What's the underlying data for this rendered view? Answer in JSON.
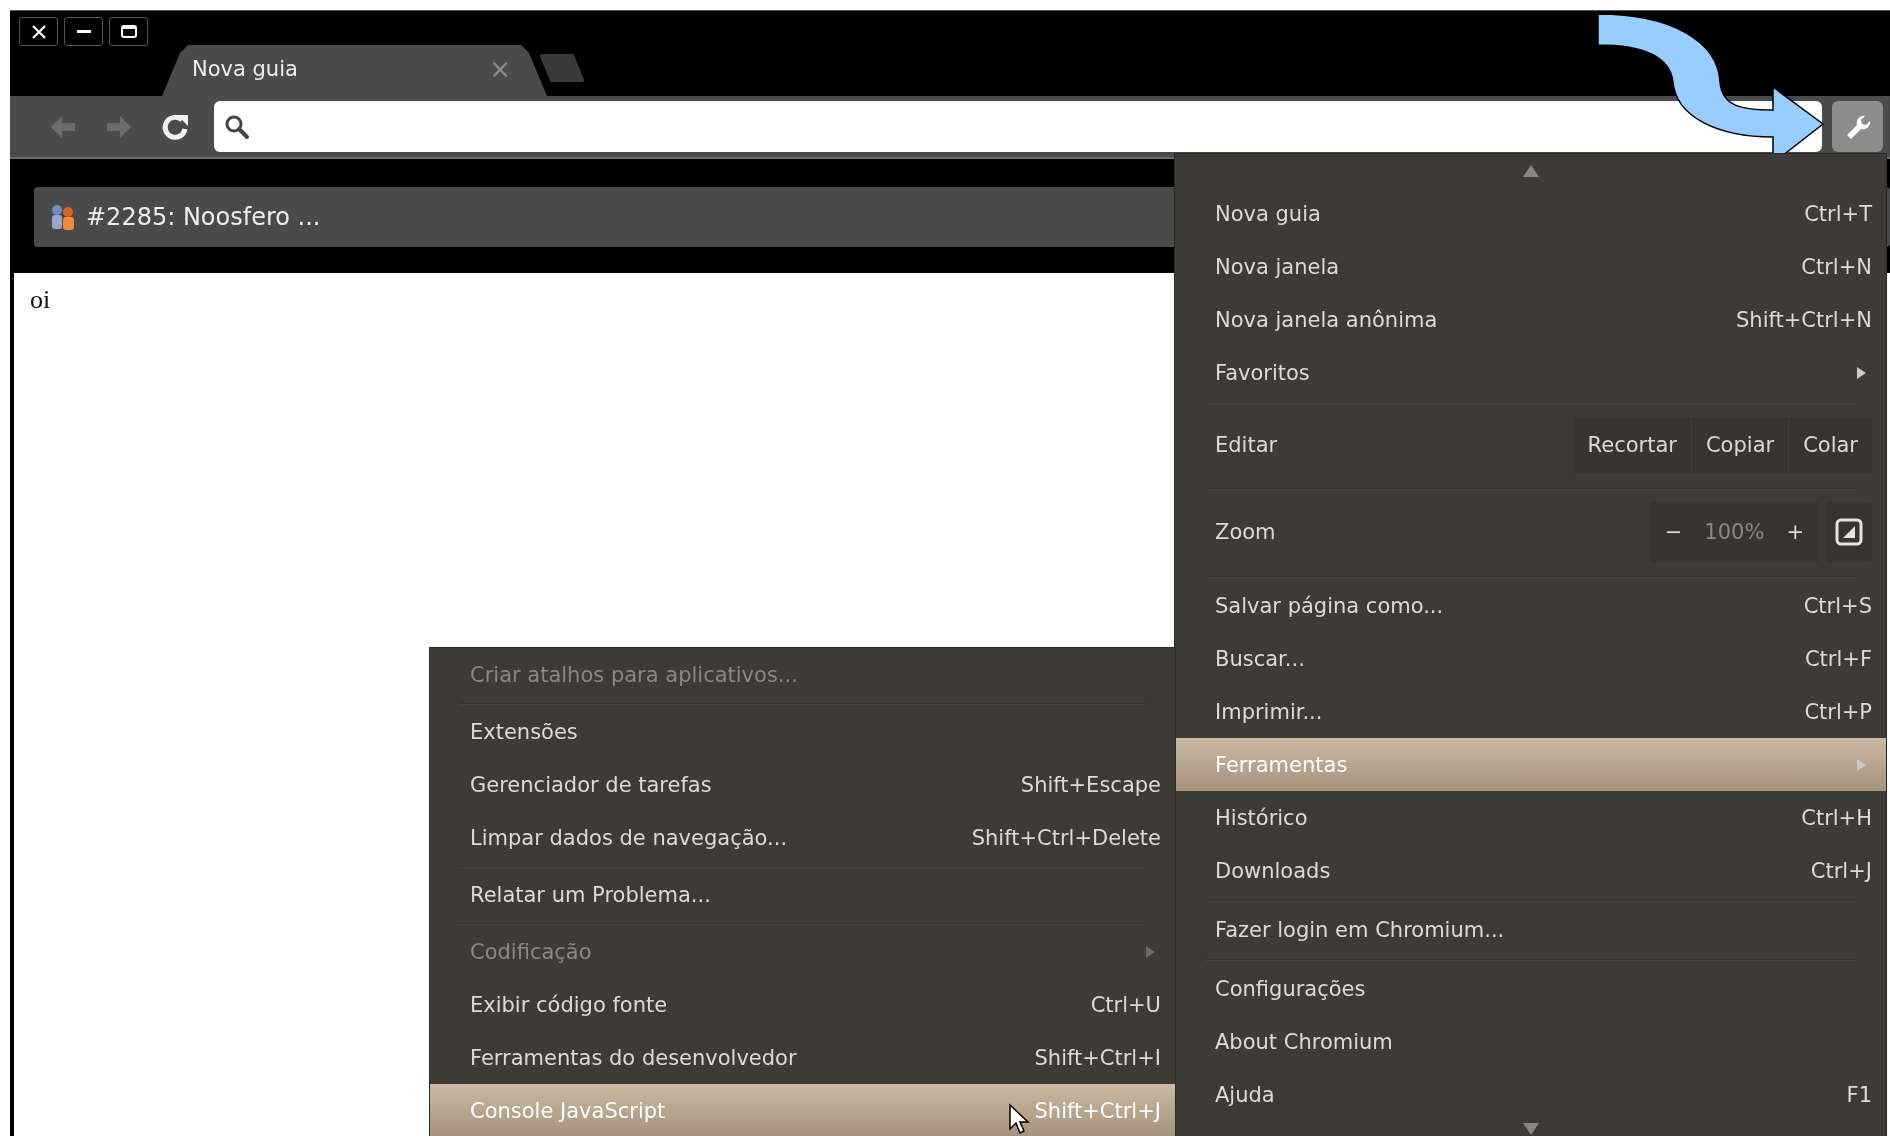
{
  "window": {
    "buttons": [
      {
        "kind": "close"
      },
      {
        "kind": "minimize"
      },
      {
        "kind": "maximize"
      }
    ]
  },
  "tabs": [
    {
      "title": "Nova guia",
      "close": "×",
      "selected": true
    }
  ],
  "toolbar": {
    "buttons": [
      {
        "kind": "back",
        "disabled": true
      },
      {
        "kind": "forward",
        "disabled": true
      },
      {
        "kind": "reload",
        "disabled": false
      }
    ]
  },
  "infobar": {
    "title": "#2285: Noosfero ..."
  },
  "page": {
    "text": "oi"
  },
  "annotation": {
    "kind": "curved-arrow"
  },
  "menu": {
    "items": [
      {
        "kind": "item",
        "label": "Nova guia",
        "shortcut": "Ctrl+T",
        "selected": false,
        "disabled": false
      },
      {
        "kind": "item",
        "label": "Nova janela",
        "shortcut": "Ctrl+N",
        "selected": false,
        "disabled": false
      },
      {
        "kind": "item",
        "label": "Nova janela anônima",
        "shortcut": "Shift+Ctrl+N",
        "selected": false,
        "disabled": false
      },
      {
        "kind": "submenu",
        "label": "Favoritos",
        "selected": false,
        "disabled": false
      },
      {
        "kind": "separator"
      },
      {
        "kind": "edit",
        "label": "Editar",
        "buttons": [
          "Recortar",
          "Copiar",
          "Colar"
        ]
      },
      {
        "kind": "separator"
      },
      {
        "kind": "zoom",
        "label": "Zoom",
        "decrease": "−",
        "value": "100%",
        "increase": "+"
      },
      {
        "kind": "separator"
      },
      {
        "kind": "item",
        "label": "Salvar página como...",
        "shortcut": "Ctrl+S",
        "selected": false,
        "disabled": false
      },
      {
        "kind": "item",
        "label": "Buscar...",
        "shortcut": "Ctrl+F",
        "selected": false,
        "disabled": false
      },
      {
        "kind": "item",
        "label": "Imprimir...",
        "shortcut": "Ctrl+P",
        "selected": false,
        "disabled": false
      },
      {
        "kind": "submenu",
        "label": "Ferramentas",
        "selected": true,
        "disabled": false
      },
      {
        "kind": "item",
        "label": "Histórico",
        "shortcut": "Ctrl+H",
        "selected": false,
        "disabled": false
      },
      {
        "kind": "item",
        "label": "Downloads",
        "shortcut": "Ctrl+J",
        "selected": false,
        "disabled": false
      },
      {
        "kind": "separator"
      },
      {
        "kind": "item",
        "label": "Fazer login em Chromium...",
        "selected": false,
        "disabled": false
      },
      {
        "kind": "separator"
      },
      {
        "kind": "item",
        "label": "Configurações",
        "selected": false,
        "disabled": false
      },
      {
        "kind": "item",
        "label": "About Chromium",
        "selected": false,
        "disabled": false
      },
      {
        "kind": "item",
        "label": "Ajuda",
        "shortcut": "F1",
        "selected": false,
        "disabled": false
      }
    ]
  },
  "submenu": {
    "items": [
      {
        "kind": "item",
        "label": "Criar atalhos para aplicativos...",
        "selected": false,
        "disabled": true
      },
      {
        "kind": "separator"
      },
      {
        "kind": "item",
        "label": "Extensões",
        "selected": false,
        "disabled": false
      },
      {
        "kind": "item",
        "label": "Gerenciador de tarefas",
        "shortcut": "Shift+Escape",
        "selected": false,
        "disabled": false
      },
      {
        "kind": "item",
        "label": "Limpar dados de navegação...",
        "shortcut": "Shift+Ctrl+Delete",
        "selected": false,
        "disabled": false
      },
      {
        "kind": "separator"
      },
      {
        "kind": "item",
        "label": "Relatar um Problema...",
        "selected": false,
        "disabled": false
      },
      {
        "kind": "separator"
      },
      {
        "kind": "submenu",
        "label": "Codificação",
        "selected": false,
        "disabled": true
      },
      {
        "kind": "item",
        "label": "Exibir código fonte",
        "shortcut": "Ctrl+U",
        "selected": false,
        "disabled": false
      },
      {
        "kind": "item",
        "label": "Ferramentas do desenvolvedor",
        "shortcut": "Shift+Ctrl+I",
        "selected": false,
        "disabled": false
      },
      {
        "kind": "item",
        "label": "Console JavaScript",
        "shortcut": "Shift+Ctrl+J",
        "selected": true,
        "disabled": false
      }
    ]
  }
}
